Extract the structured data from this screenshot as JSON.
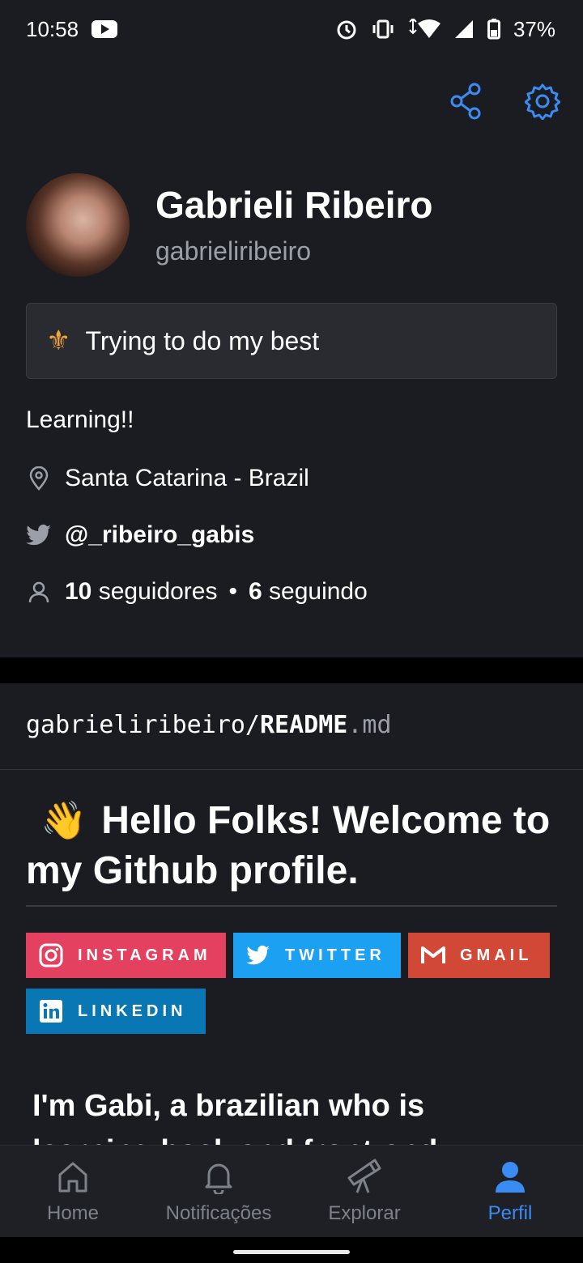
{
  "status_bar": {
    "time": "10:58",
    "battery": "37%"
  },
  "profile": {
    "name": "Gabrieli Ribeiro",
    "username": "gabrieliribeiro",
    "status_text": "Trying to do my best",
    "bio": "Learning!!",
    "location": "Santa Catarina - Brazil",
    "twitter": "@_ribeiro_gabis",
    "followers_count": "10",
    "followers_label": "seguidores",
    "following_count": "6",
    "following_label": "seguindo"
  },
  "readme": {
    "owner": "gabrieliribeiro/",
    "file": "README",
    "ext": ".md",
    "heading_emoji": "👋",
    "heading": "Hello Folks! Welcome to my Github profile.",
    "badges": [
      {
        "label": "INSTAGRAM",
        "color": "#e4405f"
      },
      {
        "label": "TWITTER",
        "color": "#1ca0f2"
      },
      {
        "label": "GMAIL",
        "color": "#d14836"
      },
      {
        "label": "LINKEDIN",
        "color": "#0a77b5"
      }
    ],
    "paragraph": "I'm Gabi, a brazilian who is learning back and front-end"
  },
  "nav": {
    "items": [
      {
        "label": "Home",
        "icon": "home-icon"
      },
      {
        "label": "Notificações",
        "icon": "bell-icon"
      },
      {
        "label": "Explorar",
        "icon": "telescope-icon"
      },
      {
        "label": "Perfil",
        "icon": "person-icon"
      }
    ]
  },
  "colors": {
    "accent": "#3b8cf2",
    "background": "#1b1c21"
  }
}
